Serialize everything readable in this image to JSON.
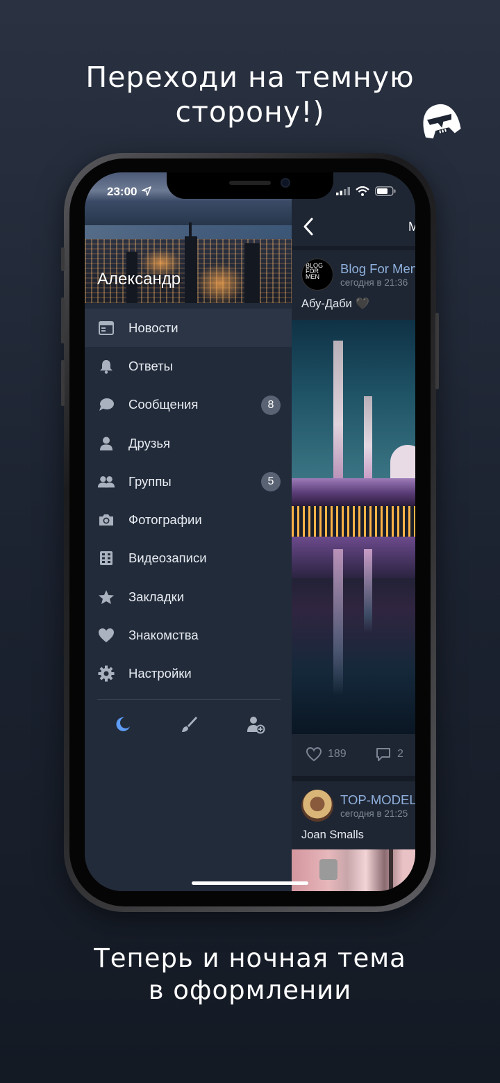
{
  "promo": {
    "headline_line1": "Переходи на темную",
    "headline_line2": "сторону!)",
    "footer_line1": "Теперь и ночная тема",
    "footer_line2": "в оформлении"
  },
  "status_bar": {
    "time": "23:00",
    "location_icon": "location-arrow-icon",
    "signal_icon": "signal-icon",
    "wifi_icon": "wifi-icon",
    "battery_icon": "battery-icon"
  },
  "sidebar": {
    "user_name": "Александр",
    "items": [
      {
        "label": "Новости",
        "icon": "newspaper-icon",
        "active": true
      },
      {
        "label": "Ответы",
        "icon": "bell-icon"
      },
      {
        "label": "Сообщения",
        "icon": "chat-bubble-icon",
        "badge": "8"
      },
      {
        "label": "Друзья",
        "icon": "person-icon"
      },
      {
        "label": "Группы",
        "icon": "people-icon",
        "badge": "5"
      },
      {
        "label": "Фотографии",
        "icon": "camera-icon"
      },
      {
        "label": "Видеозаписи",
        "icon": "film-icon"
      },
      {
        "label": "Закладки",
        "icon": "star-icon"
      },
      {
        "label": "Знакомства",
        "icon": "heart-icon"
      },
      {
        "label": "Настройки",
        "icon": "gear-icon"
      }
    ],
    "bottom_icons": [
      "moon-icon",
      "brush-icon",
      "add-account-icon"
    ],
    "accent_color": "#5e9cf5"
  },
  "feed": {
    "nav_title_partial": "М",
    "posts": [
      {
        "avatar_text": [
          "BLOG",
          "FOR",
          "MEN"
        ],
        "source": "Blog For Men",
        "date": "сегодня в 21:36",
        "text": "Абу-Даби 🖤",
        "likes": "189",
        "comments": "2"
      },
      {
        "source": "TOP-MODELS",
        "date": "сегодня в 21:25",
        "text": "Joan Smalls"
      }
    ]
  }
}
